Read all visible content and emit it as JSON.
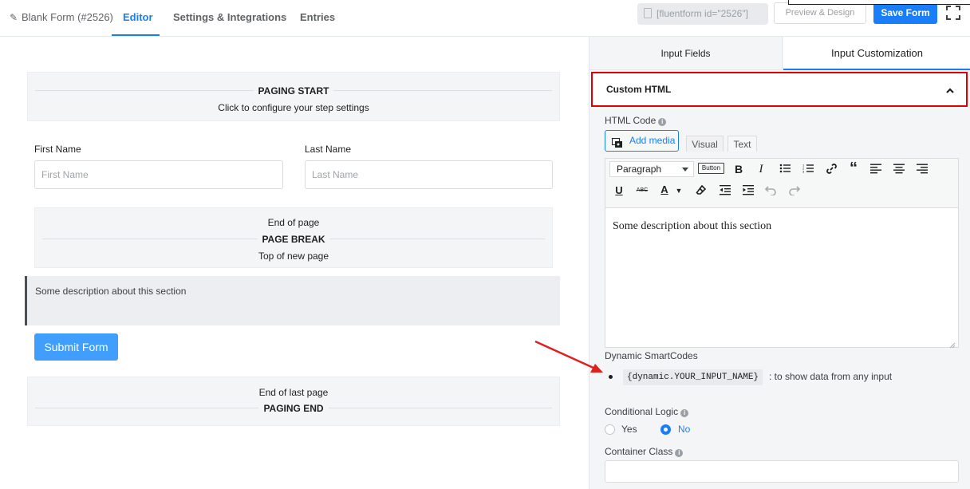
{
  "header": {
    "form_title": "Blank Form (#2526)",
    "tabs": [
      "Editor",
      "Settings & Integrations",
      "Entries"
    ],
    "active_tab": "Editor",
    "shortcode": "[fluentform id=\"2526\"]",
    "preview_label": "Preview & Design",
    "save_label": "Save Form"
  },
  "form": {
    "paging_start": {
      "title": "PAGING START",
      "subtitle": "Click to configure your step settings"
    },
    "first_name": {
      "label": "First Name",
      "placeholder": "First Name"
    },
    "last_name": {
      "label": "Last Name",
      "placeholder": "Last Name"
    },
    "page_break": {
      "top": "End of page",
      "title": "PAGE BREAK",
      "bottom": "Top of new page"
    },
    "html_section_text": "Some description about this section",
    "submit_label": "Submit Form",
    "paging_end": {
      "top": "End of last page",
      "title": "PAGING END"
    }
  },
  "sidebar": {
    "tabs": [
      "Input Fields",
      "Input Customization"
    ],
    "active_tab": "Input Customization",
    "section_title": "Custom HTML",
    "html_code_label": "HTML Code",
    "add_media_label": "Add media",
    "mode_tabs": [
      "Visual",
      "Text"
    ],
    "active_mode": "Visual",
    "format_select": "Paragraph",
    "button_mini_label": "Button",
    "editor_content": "Some description about this section",
    "smartcodes_label": "Dynamic SmartCodes",
    "smartcode": "{dynamic.YOUR_INPUT_NAME}",
    "smartcode_desc": ": to show data from any input",
    "conditional_label": "Conditional Logic",
    "conditional_options": [
      "Yes",
      "No"
    ],
    "conditional_selected": "No",
    "container_class_label": "Container Class",
    "container_class_value": ""
  },
  "colors": {
    "accent": "#1a7efb",
    "highlight_border": "#e10000",
    "annotation_arrow": "#e01f1f",
    "submit": "#409eff"
  }
}
